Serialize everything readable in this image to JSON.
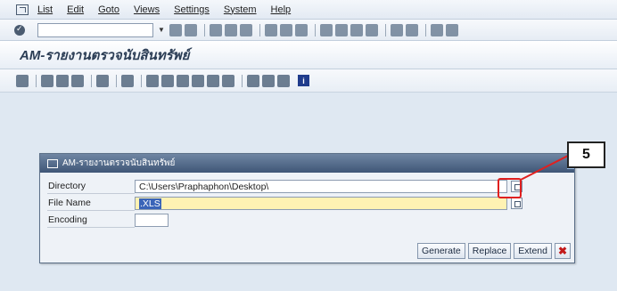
{
  "menubar": {
    "items": [
      "List",
      "Edit",
      "Goto",
      "Views",
      "Settings",
      "System",
      "Help"
    ]
  },
  "stdbar": {
    "command_field": ""
  },
  "titlebar": {
    "title": "AM-รายงานตรวจนับสินทรัพย์"
  },
  "dialog": {
    "title": "AM-รายงานตรวจนับสินทรัพย์",
    "fields": [
      {
        "label": "Directory",
        "value": "C:\\Users\\Praphaphon\\Desktop\\"
      },
      {
        "label": "File Name",
        "value": ".XLS"
      },
      {
        "label": "Encoding",
        "value": ""
      }
    ],
    "buttons": {
      "generate": "Generate",
      "replace": "Replace",
      "extend": "Extend",
      "cancel": "✖"
    }
  },
  "annotation": {
    "label": "5",
    "color": "#e0201f"
  }
}
